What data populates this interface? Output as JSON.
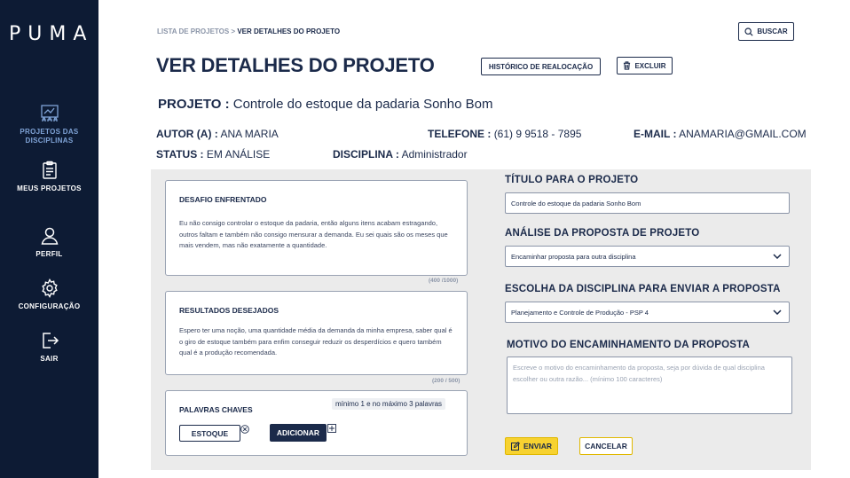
{
  "sidebar": {
    "logo": "PUMA",
    "items": [
      {
        "label": "PROJETOS DAS DISCIPLINAS",
        "icon": "projects-board-icon",
        "active": true
      },
      {
        "label": "MEUS PROJETOS",
        "icon": "clipboard-icon",
        "active": false
      },
      {
        "label": "PERFIL",
        "icon": "user-icon",
        "active": false
      },
      {
        "label": "CONFIGURAÇÃO",
        "icon": "gear-icon",
        "active": false
      },
      {
        "label": "SAIR",
        "icon": "logout-icon",
        "active": false
      }
    ]
  },
  "breadcrumb": {
    "parent": "LISTA DE PROJETOS",
    "separator": " > ",
    "current": "VER DETALHES DO PROJETO"
  },
  "header": {
    "search_label": "BUSCAR",
    "title": "VER DETALHES DO PROJETO",
    "history_label": "HISTÓRICO DE REALOCAÇÃO",
    "delete_label": "EXCLUIR"
  },
  "project": {
    "label": "PROJETO :",
    "name": "Controle do estoque da padaria Sonho Bom",
    "author_label": "AUTOR (A) :",
    "author": "ANA MARIA",
    "phone_label": "TELEFONE :",
    "phone": "(61)  9 9518 - 7895",
    "email_label": "E-MAIL :",
    "email": "ANAMARIA@GMAIL.COM",
    "status_label": "STATUS :",
    "status": "EM ANÁLISE",
    "discipline_label": "DISCIPLINA :",
    "discipline": "Administrador"
  },
  "challenge": {
    "title": "DESAFIO ENFRENTADO",
    "text": "Eu não consigo controlar o estoque da padaria, então alguns itens acabam estragando, outros faltam e também não consigo mensurar a demanda. Eu sei quais são os meses que mais vendem, mas não exatamente a quantidade.",
    "counter": "(400 /1000)"
  },
  "results": {
    "title": "RESULTADOS DESEJADOS",
    "text": "Espero ter uma noção, uma quantidade média da demanda da minha empresa, saber qual é o giro de estoque também para enfim conseguir reduzir os desperdícios e quero também qual é a produção recomendada.",
    "counter": "(200 / 500)"
  },
  "keywords": {
    "title": "PALAVRAS CHAVES",
    "hint": "mínimo 1 e no máximo 3 palavras",
    "tag": "ESTOQUE",
    "add_label": "ADICIONAR"
  },
  "form": {
    "title_label": "TÍTULO PARA O PROJETO",
    "title_value": "Controle do estoque da padaria Sonho Bom",
    "analysis_label": "ANÁLISE DA PROPOSTA DE PROJETO",
    "analysis_value": "Encaminhar proposta para outra disciplina",
    "discipline_label": "ESCOLHA DA DISCIPLINA PARA ENVIAR A PROPOSTA",
    "discipline_value": "Planejamento e Controle de Produção - PSP 4",
    "reason_label": "MOTIVO DO ENCAMINHAMENTO DA PROPOSTA",
    "reason_placeholder": "Escreve o motivo do encaminhamento da proposta, seja por dúvida de qual disciplina escolher ou outra razão... (mínimo 100 caracteres)",
    "send_label": "ENVIAR",
    "cancel_label": "CANCELAR"
  },
  "colors": {
    "navy": "#0d1b34",
    "accent_yellow": "#f7d230",
    "active_nav": "#7fa3d6"
  }
}
